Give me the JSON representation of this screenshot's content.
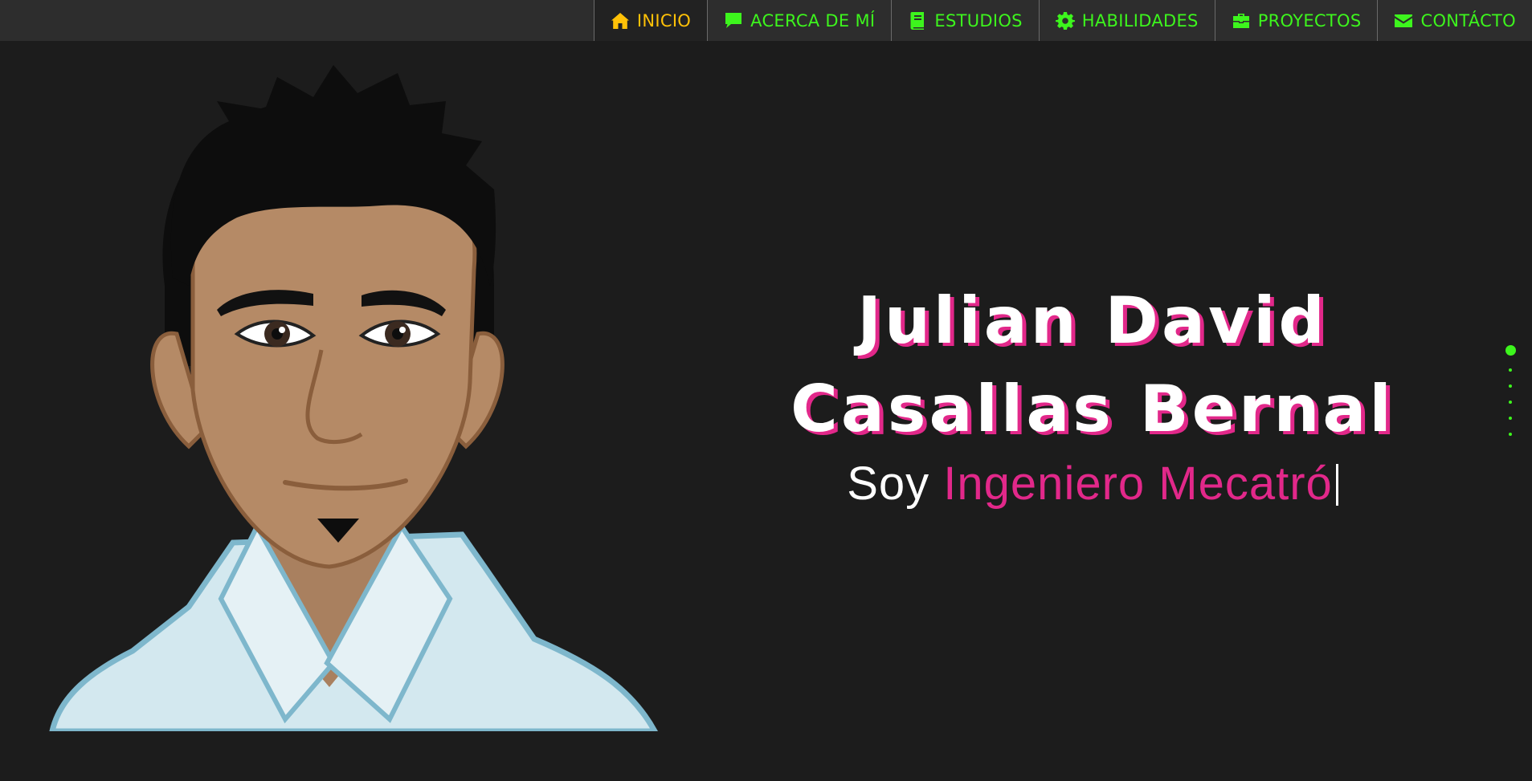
{
  "nav": {
    "items": [
      {
        "label": "INICIO",
        "icon": "home-icon",
        "active": true
      },
      {
        "label": "ACERCA DE MÍ",
        "icon": "comment-icon",
        "active": false
      },
      {
        "label": "ESTUDIOS",
        "icon": "book-icon",
        "active": false
      },
      {
        "label": "HABILIDADES",
        "icon": "gear-icon",
        "active": false
      },
      {
        "label": "PROYECTOS",
        "icon": "briefcase-icon",
        "active": false
      },
      {
        "label": "CONTÁCTO",
        "icon": "envelope-icon",
        "active": false
      }
    ]
  },
  "hero": {
    "name_line1": "Julian David",
    "name_line2": "Casallas Bernal",
    "sub_prefix": "Soy",
    "sub_typed": "Ingeniero Mecatró"
  },
  "colors": {
    "background": "#1c1c1c",
    "topbar": "#2d2d2d",
    "nav_text": "#3df51d",
    "nav_active": "#ffc107",
    "accent_pink": "#e2288a"
  },
  "pager": {
    "count": 6,
    "active_index": 0
  }
}
